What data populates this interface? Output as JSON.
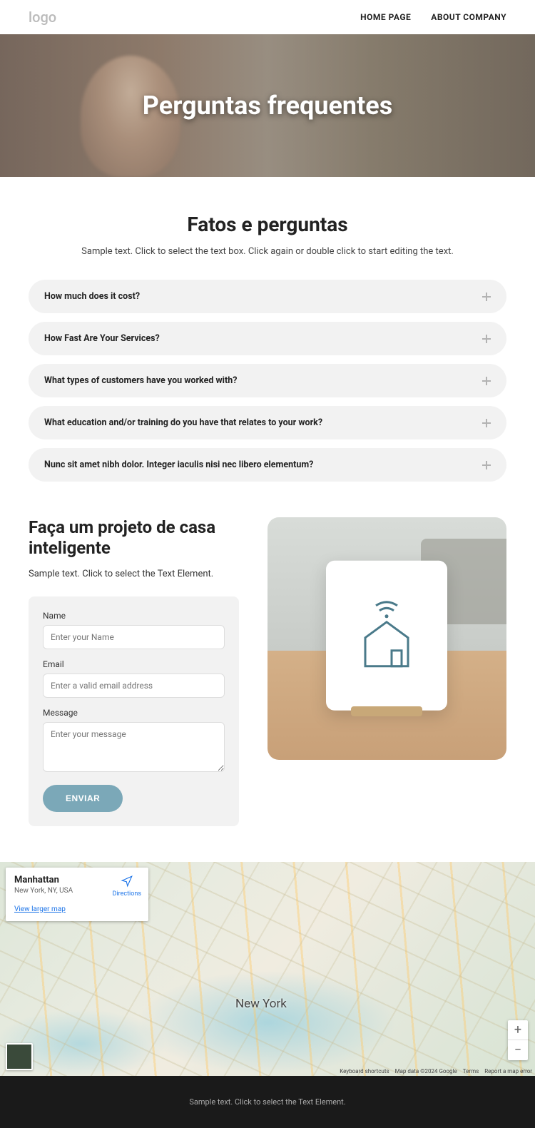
{
  "header": {
    "logo": "logo",
    "nav": [
      "HOME PAGE",
      "ABOUT COMPANY"
    ]
  },
  "hero": {
    "title": "Perguntas frequentes"
  },
  "faq": {
    "heading": "Fatos e perguntas",
    "subtext": "Sample text. Click to select the text box. Click again or double click to start editing the text.",
    "items": [
      "How much does it cost?",
      "How Fast Are Your Services?",
      "What types of customers have you worked with?",
      "What education and/or training do you have that relates to your work?",
      "Nunc sit amet nibh dolor. Integer iaculis nisi nec libero elementum?"
    ]
  },
  "contact": {
    "heading": "Faça um projeto de casa inteligente",
    "desc": "Sample text. Click to select the Text Element.",
    "form": {
      "name_label": "Name",
      "name_placeholder": "Enter your Name",
      "email_label": "Email",
      "email_placeholder": "Enter a valid email address",
      "message_label": "Message",
      "message_placeholder": "Enter your message",
      "submit": "ENVIAR"
    }
  },
  "map": {
    "card_title": "Manhattan",
    "card_addr": "New York, NY, USA",
    "directions": "Directions",
    "larger": "View larger map",
    "city_label": "New York",
    "footer": [
      "Keyboard shortcuts",
      "Map data ©2024 Google",
      "Terms",
      "Report a map error"
    ]
  },
  "footer": {
    "text": "Sample text. Click to select the Text Element."
  }
}
